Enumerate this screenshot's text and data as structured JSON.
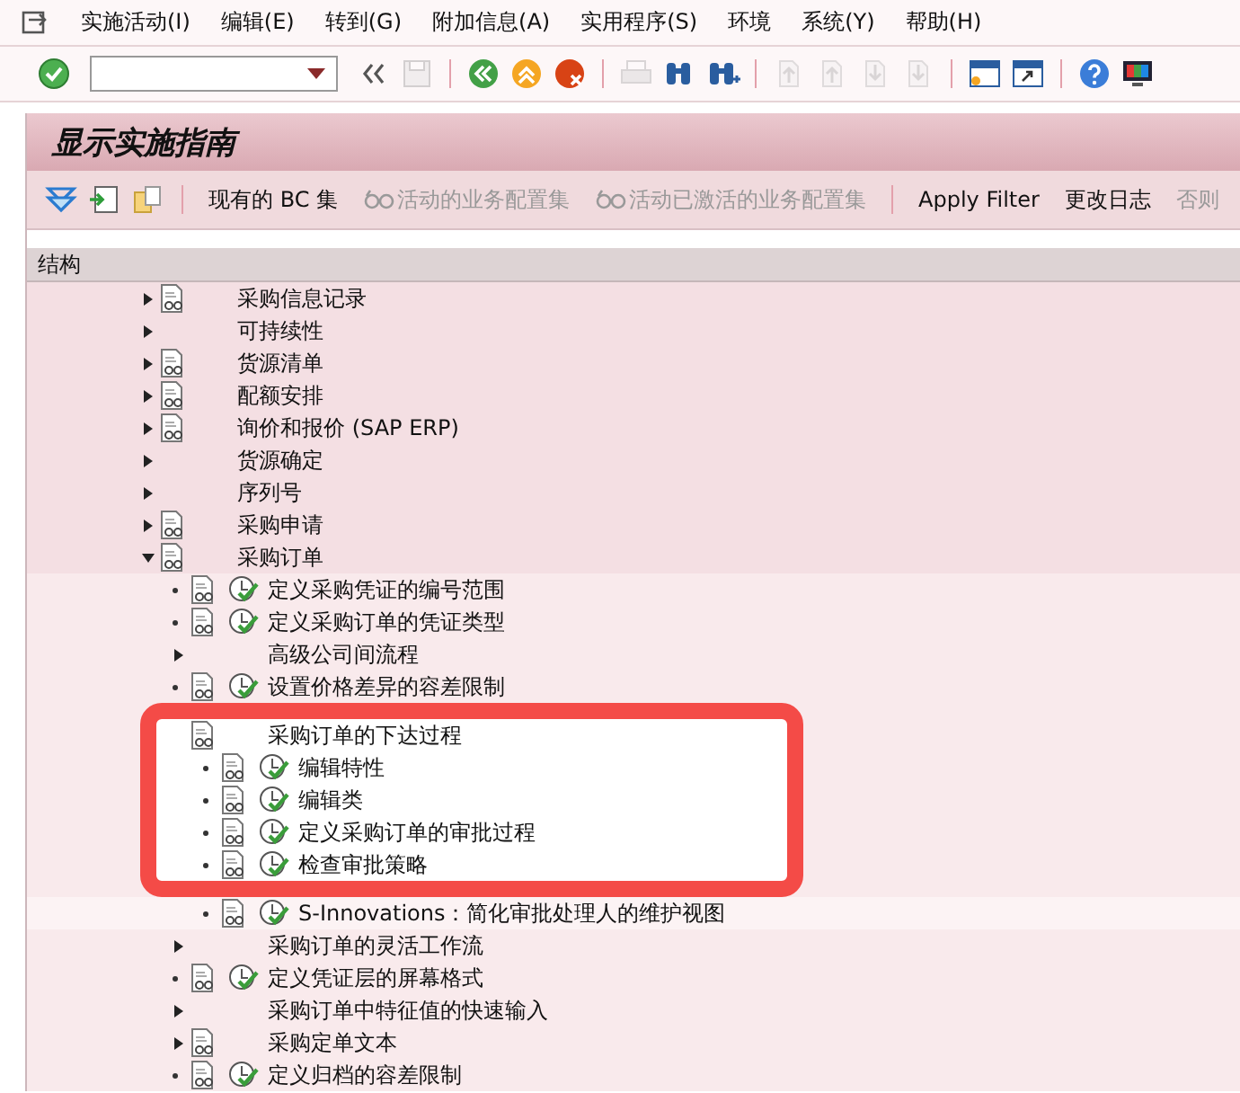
{
  "menu": [
    {
      "label": "实施活动(I)"
    },
    {
      "label": "编辑(E)"
    },
    {
      "label": "转到(G)"
    },
    {
      "label": "附加信息(A)"
    },
    {
      "label": "实用程序(S)"
    },
    {
      "label": "环境"
    },
    {
      "label": "系统(Y)"
    },
    {
      "label": "帮助(H)"
    }
  ],
  "toolbar": [
    {
      "kind": "enter",
      "disabled": false
    },
    {
      "kind": "command",
      "disabled": false
    },
    {
      "kind": "collapse",
      "disabled": false
    },
    {
      "kind": "save",
      "disabled": true
    },
    {
      "kind": "sep"
    },
    {
      "kind": "back",
      "disabled": false
    },
    {
      "kind": "exit",
      "disabled": false
    },
    {
      "kind": "cancel",
      "disabled": false
    },
    {
      "kind": "sep"
    },
    {
      "kind": "print",
      "disabled": true
    },
    {
      "kind": "find",
      "disabled": false
    },
    {
      "kind": "findnext",
      "disabled": false
    },
    {
      "kind": "sep"
    },
    {
      "kind": "first",
      "disabled": true
    },
    {
      "kind": "prev",
      "disabled": true
    },
    {
      "kind": "next",
      "disabled": true
    },
    {
      "kind": "last",
      "disabled": true
    },
    {
      "kind": "sep"
    },
    {
      "kind": "session",
      "disabled": false
    },
    {
      "kind": "shortcut",
      "disabled": false
    },
    {
      "kind": "sep"
    },
    {
      "kind": "help",
      "disabled": false
    },
    {
      "kind": "layout",
      "disabled": false
    }
  ],
  "title": "显示实施指南",
  "app_toolbar": [
    {
      "kind": "expand",
      "disabled": false
    },
    {
      "kind": "import",
      "disabled": false
    },
    {
      "kind": "paste",
      "disabled": false
    },
    {
      "kind": "sep"
    },
    {
      "kind": "text",
      "label": "现有的 BC 集",
      "disabled": false
    },
    {
      "kind": "glasses",
      "label": "活动的业务配置集",
      "disabled": true
    },
    {
      "kind": "glasses",
      "label": "活动已激活的业务配置集",
      "disabled": true
    },
    {
      "kind": "sep"
    },
    {
      "kind": "text",
      "label": "Apply Filter",
      "disabled": false
    },
    {
      "kind": "text",
      "label": "更改日志",
      "disabled": false
    },
    {
      "kind": "text",
      "label": "否则",
      "disabled": true
    }
  ],
  "tree": {
    "header": "结构",
    "nodes": [
      {
        "label": "采购信息记录",
        "kind": "folder",
        "expanded": false,
        "doc": true,
        "activity": false
      },
      {
        "label": "可持续性",
        "kind": "folder",
        "expanded": false,
        "doc": false,
        "activity": false
      },
      {
        "label": "货源清单",
        "kind": "folder",
        "expanded": false,
        "doc": true,
        "activity": false
      },
      {
        "label": "配额安排",
        "kind": "folder",
        "expanded": false,
        "doc": true,
        "activity": false
      },
      {
        "label": "询价和报价 (SAP ERP)",
        "kind": "folder",
        "expanded": false,
        "doc": true,
        "activity": false
      },
      {
        "label": "货源确定",
        "kind": "folder",
        "expanded": false,
        "doc": false,
        "activity": false
      },
      {
        "label": "序列号",
        "kind": "folder",
        "expanded": false,
        "doc": false,
        "activity": false
      },
      {
        "label": "采购申请",
        "kind": "folder",
        "expanded": false,
        "doc": true,
        "activity": false
      },
      {
        "label": "采购订单",
        "kind": "folder",
        "expanded": true,
        "doc": true,
        "activity": false,
        "children": [
          {
            "label": "定义采购凭证的编号范围",
            "kind": "leaf",
            "doc": true,
            "activity": true
          },
          {
            "label": "定义采购订单的凭证类型",
            "kind": "leaf",
            "doc": true,
            "activity": true
          },
          {
            "label": "高级公司间流程",
            "kind": "folder",
            "expanded": false,
            "doc": false,
            "activity": false
          },
          {
            "label": "设置价格差异的容差限制",
            "kind": "leaf",
            "doc": true,
            "activity": true
          },
          {
            "label": "采购订单的下达过程",
            "kind": "folder",
            "expanded": true,
            "doc": true,
            "activity": false,
            "highlighted": true,
            "children": [
              {
                "label": "编辑特性",
                "kind": "leaf",
                "doc": true,
                "activity": true
              },
              {
                "label": "编辑类",
                "kind": "leaf",
                "doc": true,
                "activity": true
              },
              {
                "label": "定义采购订单的审批过程",
                "kind": "leaf",
                "doc": true,
                "activity": true
              },
              {
                "label": "检查审批策略",
                "kind": "leaf",
                "doc": true,
                "activity": true
              },
              {
                "label": "S-Innovations：简化审批处理人的维护视图",
                "kind": "leaf",
                "doc": true,
                "activity": true
              }
            ]
          },
          {
            "label": "采购订单的灵活工作流",
            "kind": "folder",
            "expanded": false,
            "doc": false,
            "activity": false
          },
          {
            "label": "定义凭证层的屏幕格式",
            "kind": "leaf",
            "doc": true,
            "activity": true
          },
          {
            "label": "采购订单中特征值的快速输入",
            "kind": "folder",
            "expanded": false,
            "doc": false,
            "activity": false
          },
          {
            "label": "采购定单文本",
            "kind": "folder",
            "expanded": false,
            "doc": true,
            "activity": false
          },
          {
            "label": "定义归档的容差限制",
            "kind": "leaf",
            "doc": true,
            "activity": true
          }
        ]
      }
    ]
  }
}
